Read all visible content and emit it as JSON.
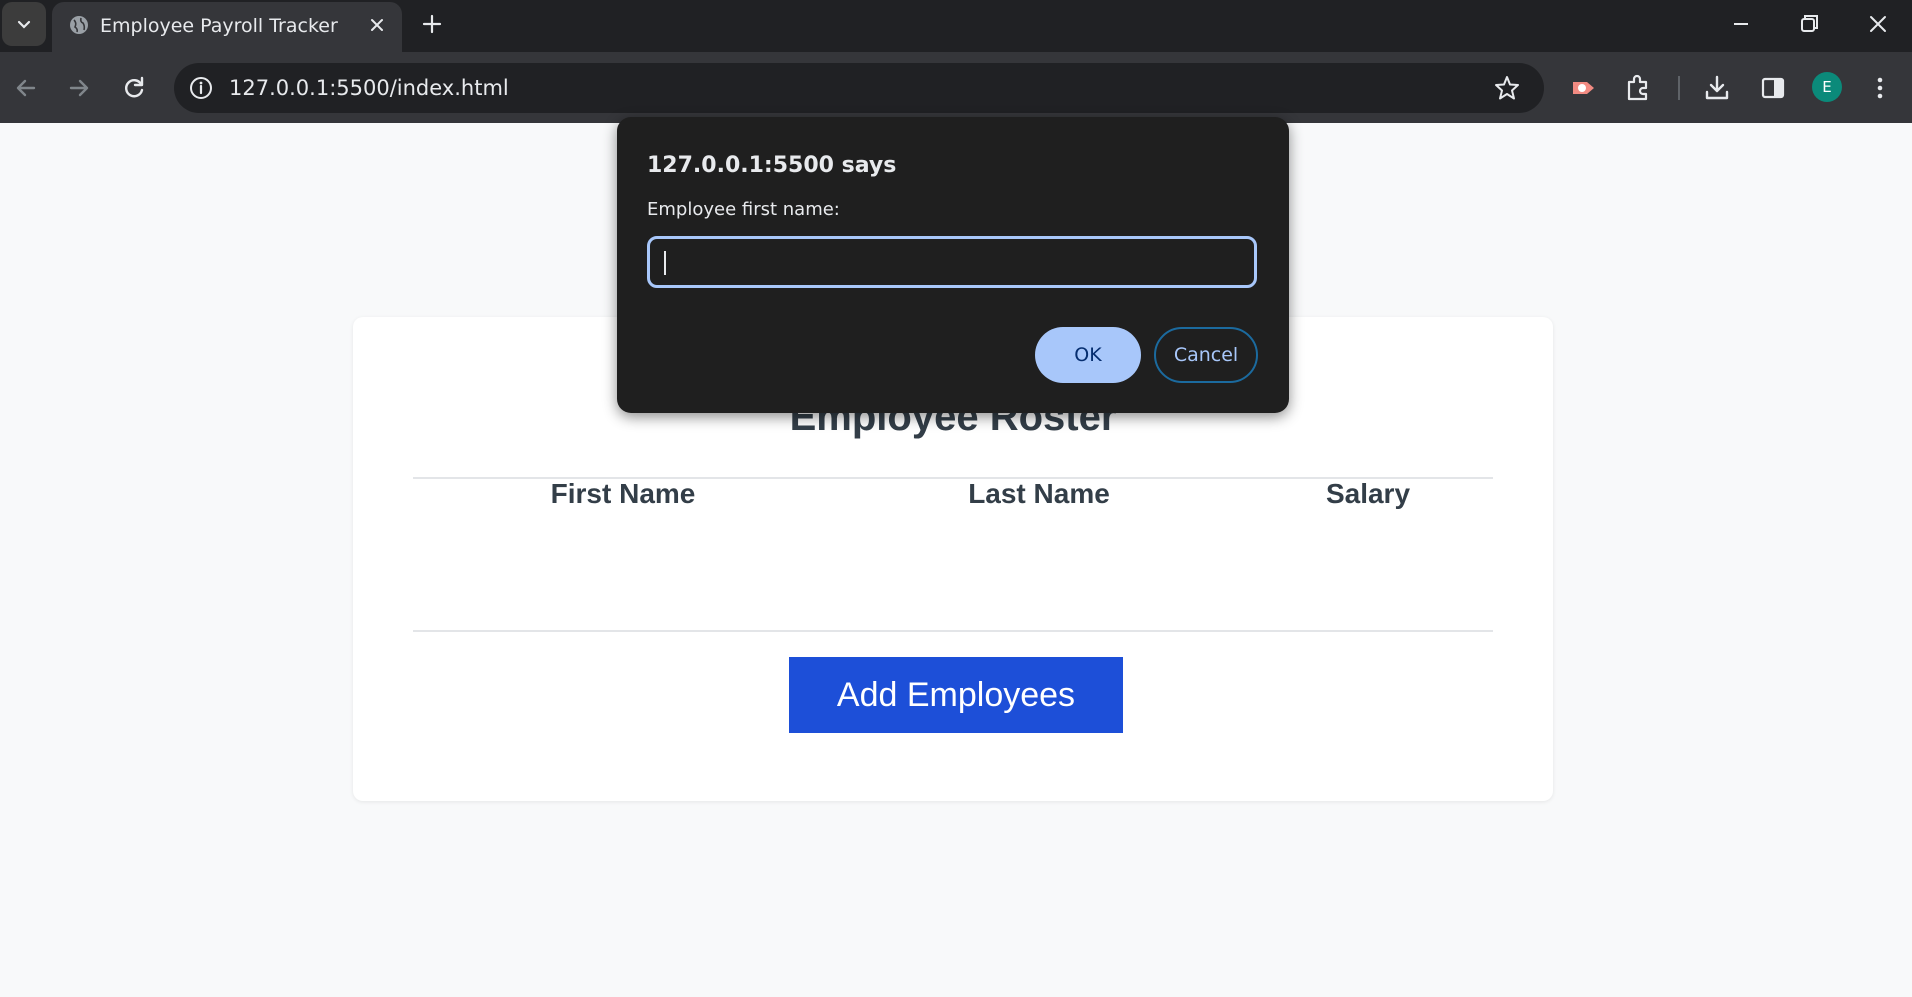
{
  "browser": {
    "tab_title": "Employee Payroll Tracker",
    "url": "127.0.0.1:5500/index.html",
    "profile_initial": "E"
  },
  "page": {
    "roster_title": "Employee Roster",
    "columns": [
      "First Name",
      "Last Name",
      "Salary"
    ],
    "add_button_label": "Add Employees",
    "accent_color": "#1d4fd8"
  },
  "dialog": {
    "title": "127.0.0.1:5500 says",
    "message": "Employee first name:",
    "input_value": "",
    "ok_label": "OK",
    "cancel_label": "Cancel"
  }
}
